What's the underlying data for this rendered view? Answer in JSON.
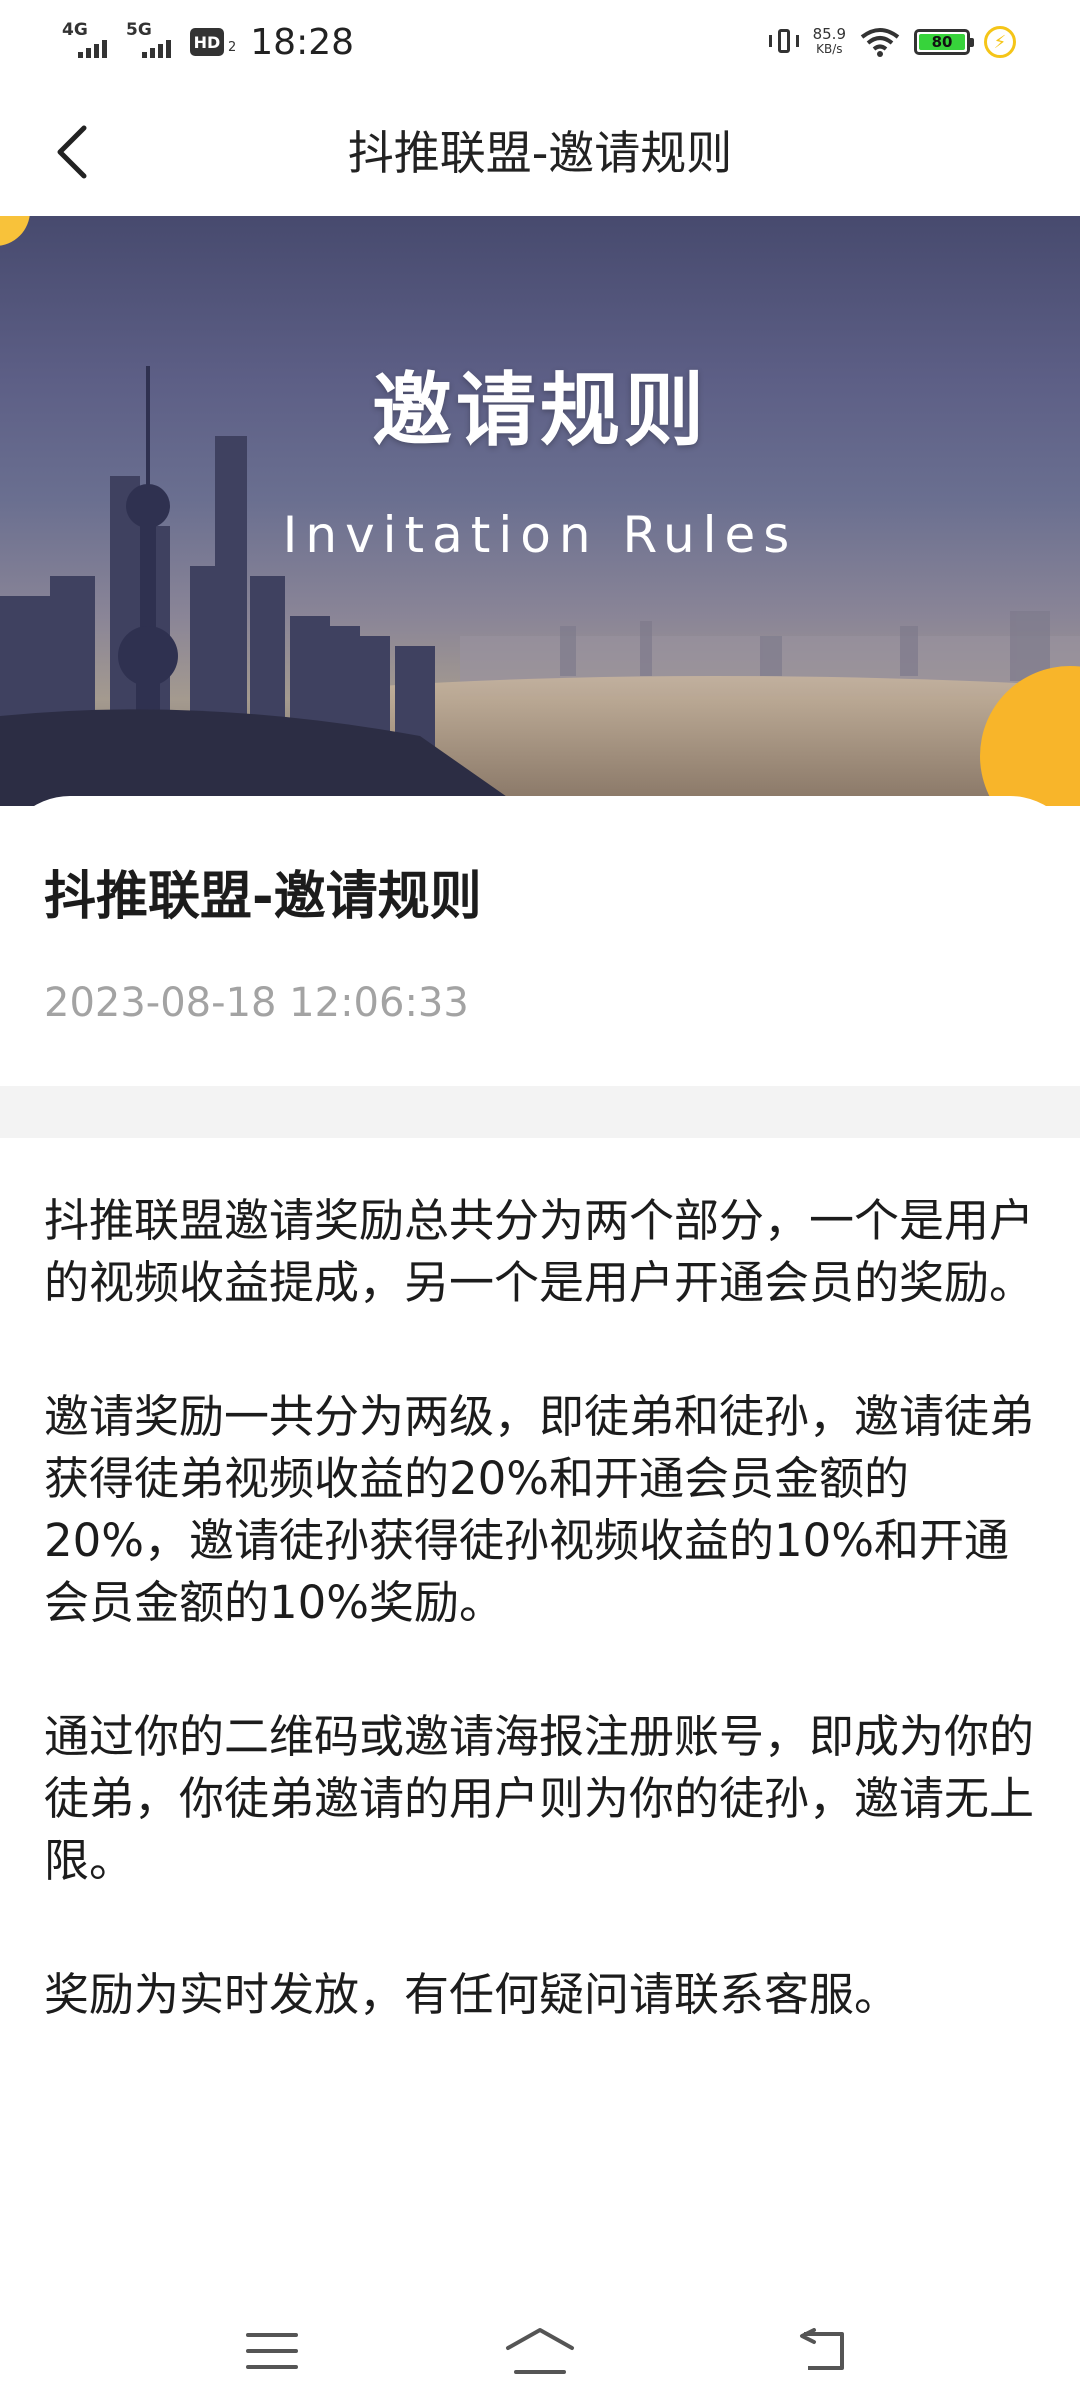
{
  "status_bar": {
    "network1": "4G",
    "network2": "5G",
    "hd_label": "HD",
    "hd_sub": "2",
    "time": "18:28",
    "speed_value": "85.9",
    "speed_unit": "KB/s",
    "battery": "80"
  },
  "navbar": {
    "title": "抖推联盟-邀请规则"
  },
  "banner": {
    "title": "邀请规则",
    "subtitle": "Invitation Rules"
  },
  "article": {
    "title": "抖推联盟-邀请规则",
    "date": "2023-08-18 12:06:33",
    "paragraphs": [
      "抖推联盟邀请奖励总共分为两个部分，一个是用户的视频收益提成，另一个是用户开通会员的奖励。",
      "邀请奖励一共分为两级，即徒弟和徒孙，邀请徒弟获得徒弟视频收益的20%和开通会员金额的20%，邀请徒孙获得徒孙视频收益的10%和开通会员金额的10%奖励。",
      "通过你的二维码或邀请海报注册账号，即成为你的徒弟，你徒弟邀请的用户则为你的徒孙，邀请无上限。",
      "奖励为实时发放，有任何疑问请联系客服。"
    ]
  },
  "colors": {
    "accent": "#f8c23a",
    "battery_fill": "#37d33b",
    "divider": "#f3f3f3",
    "date_text": "#a3a3a3"
  }
}
